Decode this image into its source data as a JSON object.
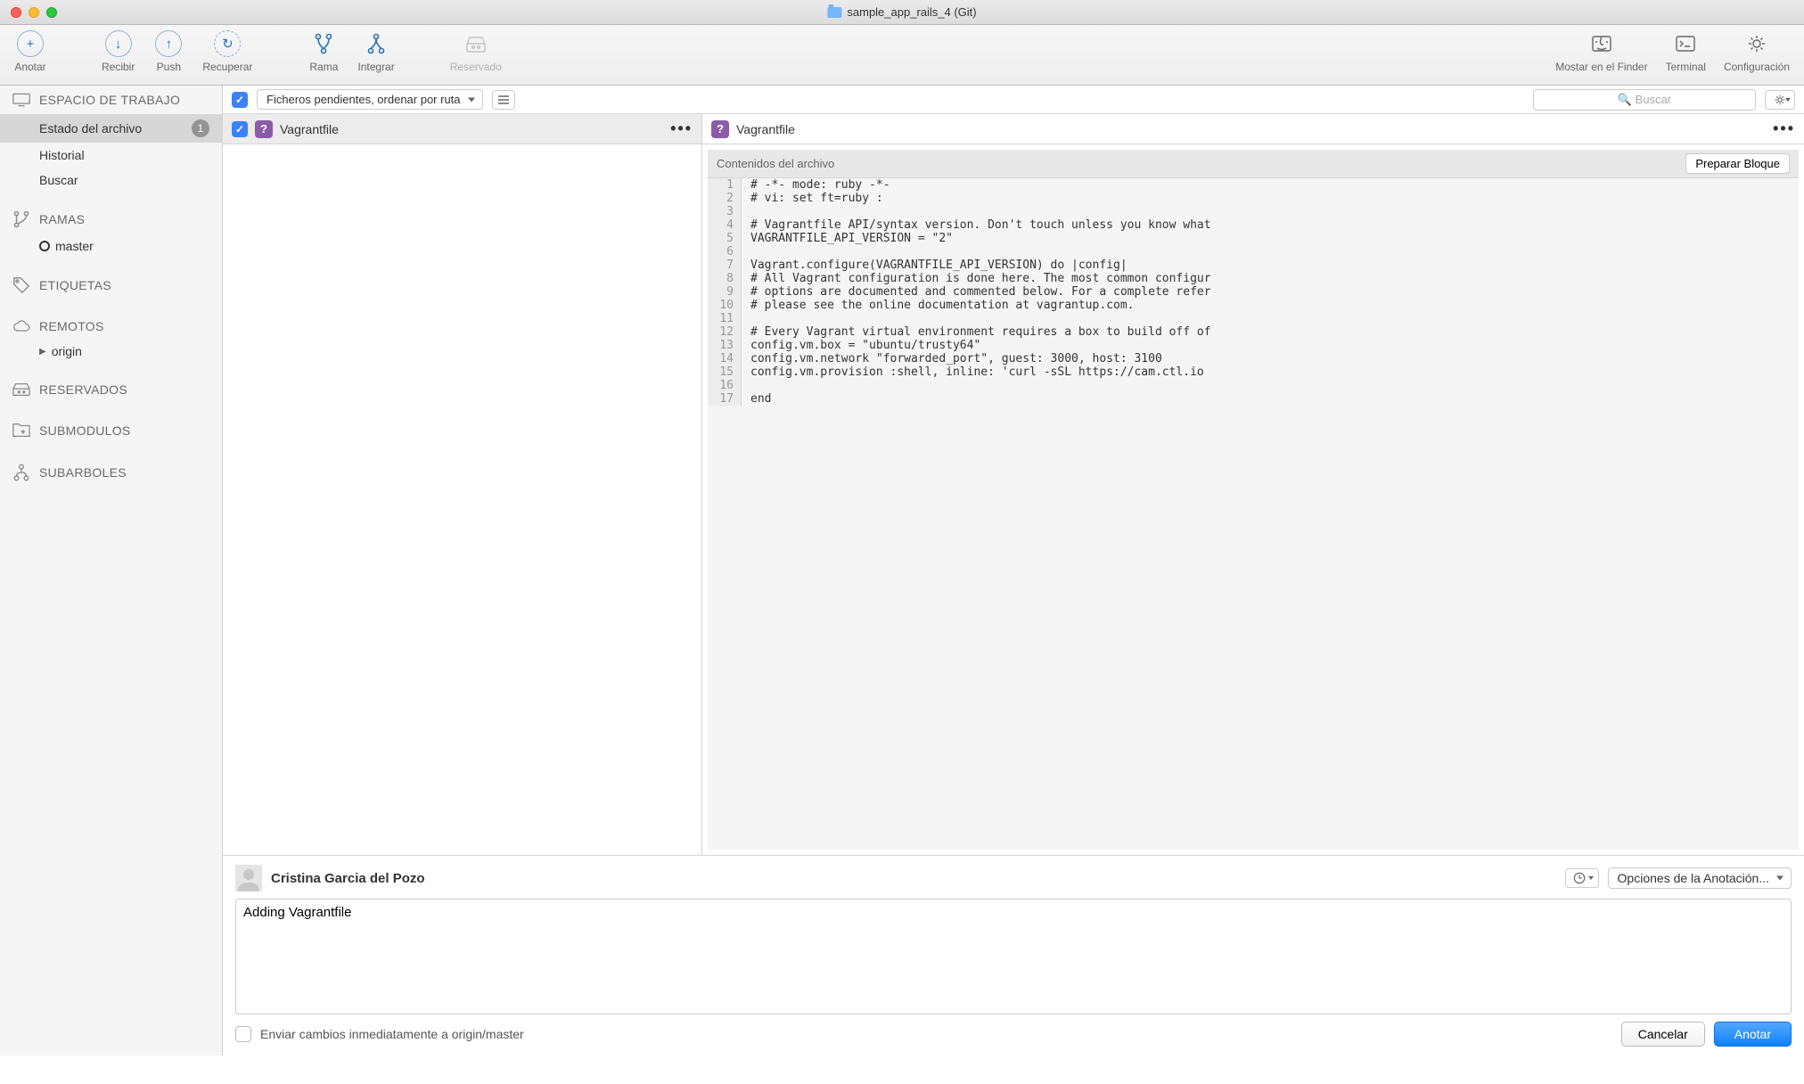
{
  "window": {
    "title": "sample_app_rails_4 (Git)"
  },
  "toolbar": {
    "items": [
      {
        "label": "Anotar"
      },
      {
        "label": "Recibir"
      },
      {
        "label": "Push"
      },
      {
        "label": "Recuperar"
      },
      {
        "label": "Rama"
      },
      {
        "label": "Integrar"
      },
      {
        "label": "Reservado"
      },
      {
        "label": "Mostar en el Finder"
      },
      {
        "label": "Terminal"
      },
      {
        "label": "Configuración"
      }
    ]
  },
  "filter": {
    "dropdown": "Ficheros pendientes, ordenar por ruta",
    "search_placeholder": "Buscar"
  },
  "sidebar": {
    "workspace": {
      "header": "ESPACIO DE TRABAJO",
      "items": [
        {
          "label": "Estado del archivo",
          "badge": "1",
          "selected": true
        },
        {
          "label": "Historial"
        },
        {
          "label": "Buscar"
        }
      ]
    },
    "branches": {
      "header": "RAMAS",
      "items": [
        {
          "label": "master"
        }
      ]
    },
    "tags": {
      "header": "ETIQUETAS"
    },
    "remotes": {
      "header": "REMOTOS",
      "items": [
        {
          "label": "origin"
        }
      ]
    },
    "stashes": {
      "header": "RESERVADOS"
    },
    "submodules": {
      "header": "SUBMODULOS"
    },
    "subtrees": {
      "header": "SUBARBOLES"
    }
  },
  "file_list": {
    "items": [
      {
        "name": "Vagrantfile"
      }
    ]
  },
  "diff": {
    "filename": "Vagrantfile",
    "subheader": "Contenidos del archivo",
    "prepare_button": "Preparar Bloque",
    "lines": [
      "# -*- mode: ruby -*-",
      "# vi: set ft=ruby :",
      "",
      "# Vagrantfile API/syntax version. Don't touch unless you know what",
      "VAGRANTFILE_API_VERSION = \"2\"",
      "",
      "Vagrant.configure(VAGRANTFILE_API_VERSION) do |config|",
      "# All Vagrant configuration is done here. The most common configur",
      "# options are documented and commented below. For a complete refer",
      "# please see the online documentation at vagrantup.com.",
      "",
      "# Every Vagrant virtual environment requires a box to build off of",
      "config.vm.box = \"ubuntu/trusty64\"",
      "config.vm.network \"forwarded_port\", guest: 3000, host: 3100",
      "config.vm.provision :shell, inline: 'curl -sSL https://cam.ctl.io",
      "",
      "end"
    ]
  },
  "commit": {
    "author": "Cristina Garcia del Pozo",
    "message": "Adding Vagrantfile",
    "options_label": "Opciones de la Anotación...",
    "push_immediately": "Enviar cambios inmediatamente a origin/master",
    "cancel": "Cancelar",
    "submit": "Anotar"
  }
}
